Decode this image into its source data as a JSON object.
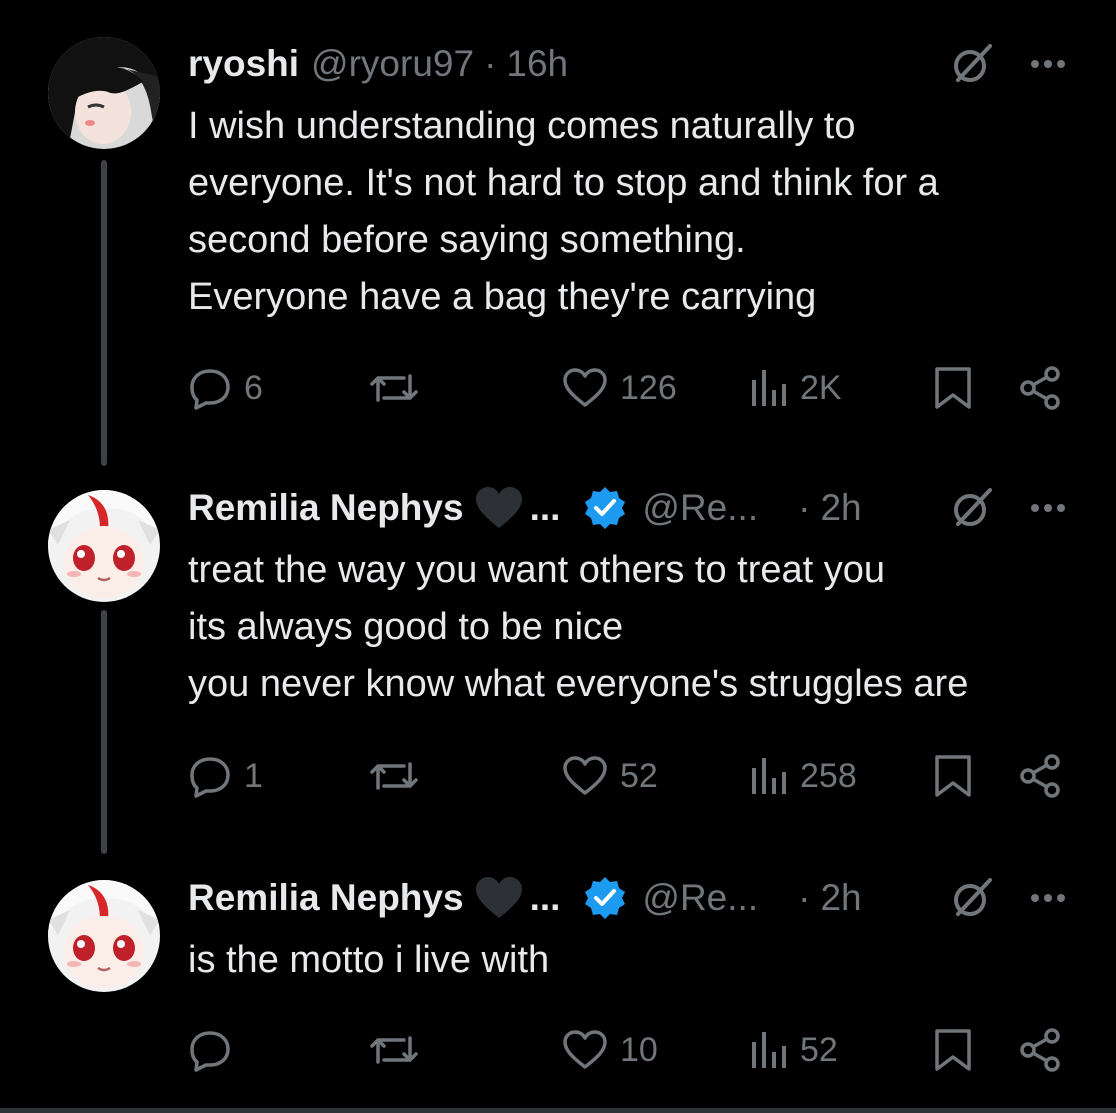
{
  "tweets": [
    {
      "author_name": "ryoshi",
      "handle": "@ryoru97",
      "dot": "·",
      "time": "16h",
      "has_badges": false,
      "text_lines": [
        "I wish understanding comes naturally to",
        "everyone. It's not hard to stop and think for a",
        "second before saying something.",
        "Everyone have a bag they're carrying"
      ],
      "stats": {
        "replies": "6",
        "retweets": "",
        "likes": "126",
        "views": "2K"
      }
    },
    {
      "author_name": "Remilia Nephys",
      "name_ellipsis": "...",
      "handle": "@Re...",
      "dot": "·",
      "time": "2h",
      "has_badges": true,
      "text_lines": [
        "treat the way you want others to treat you",
        "its always good to be nice",
        "you never know what everyone's struggles are"
      ],
      "stats": {
        "replies": "1",
        "retweets": "",
        "likes": "52",
        "views": "258"
      }
    },
    {
      "author_name": "Remilia Nephys",
      "name_ellipsis": "...",
      "handle": "@Re...",
      "dot": "·",
      "time": "2h",
      "has_badges": true,
      "text_lines": [
        "is the motto i live with"
      ],
      "stats": {
        "replies": "",
        "retweets": "",
        "likes": "10",
        "views": "52"
      }
    }
  ],
  "icons": {
    "reply": "reply-icon",
    "retweet": "retweet-icon",
    "like": "heart-icon",
    "views": "views-icon",
    "bookmark": "bookmark-icon",
    "share": "share-icon",
    "more": "more-options-icon",
    "grok": "grok-icon",
    "verified": "verified-badge-icon",
    "name_heart": "black-heart-emoji"
  },
  "colors": {
    "background": "#000000",
    "text": "#e7e9ea",
    "secondary": "#71767b",
    "verified": "#1d9bf0",
    "thread_line": "#3d4245"
  }
}
